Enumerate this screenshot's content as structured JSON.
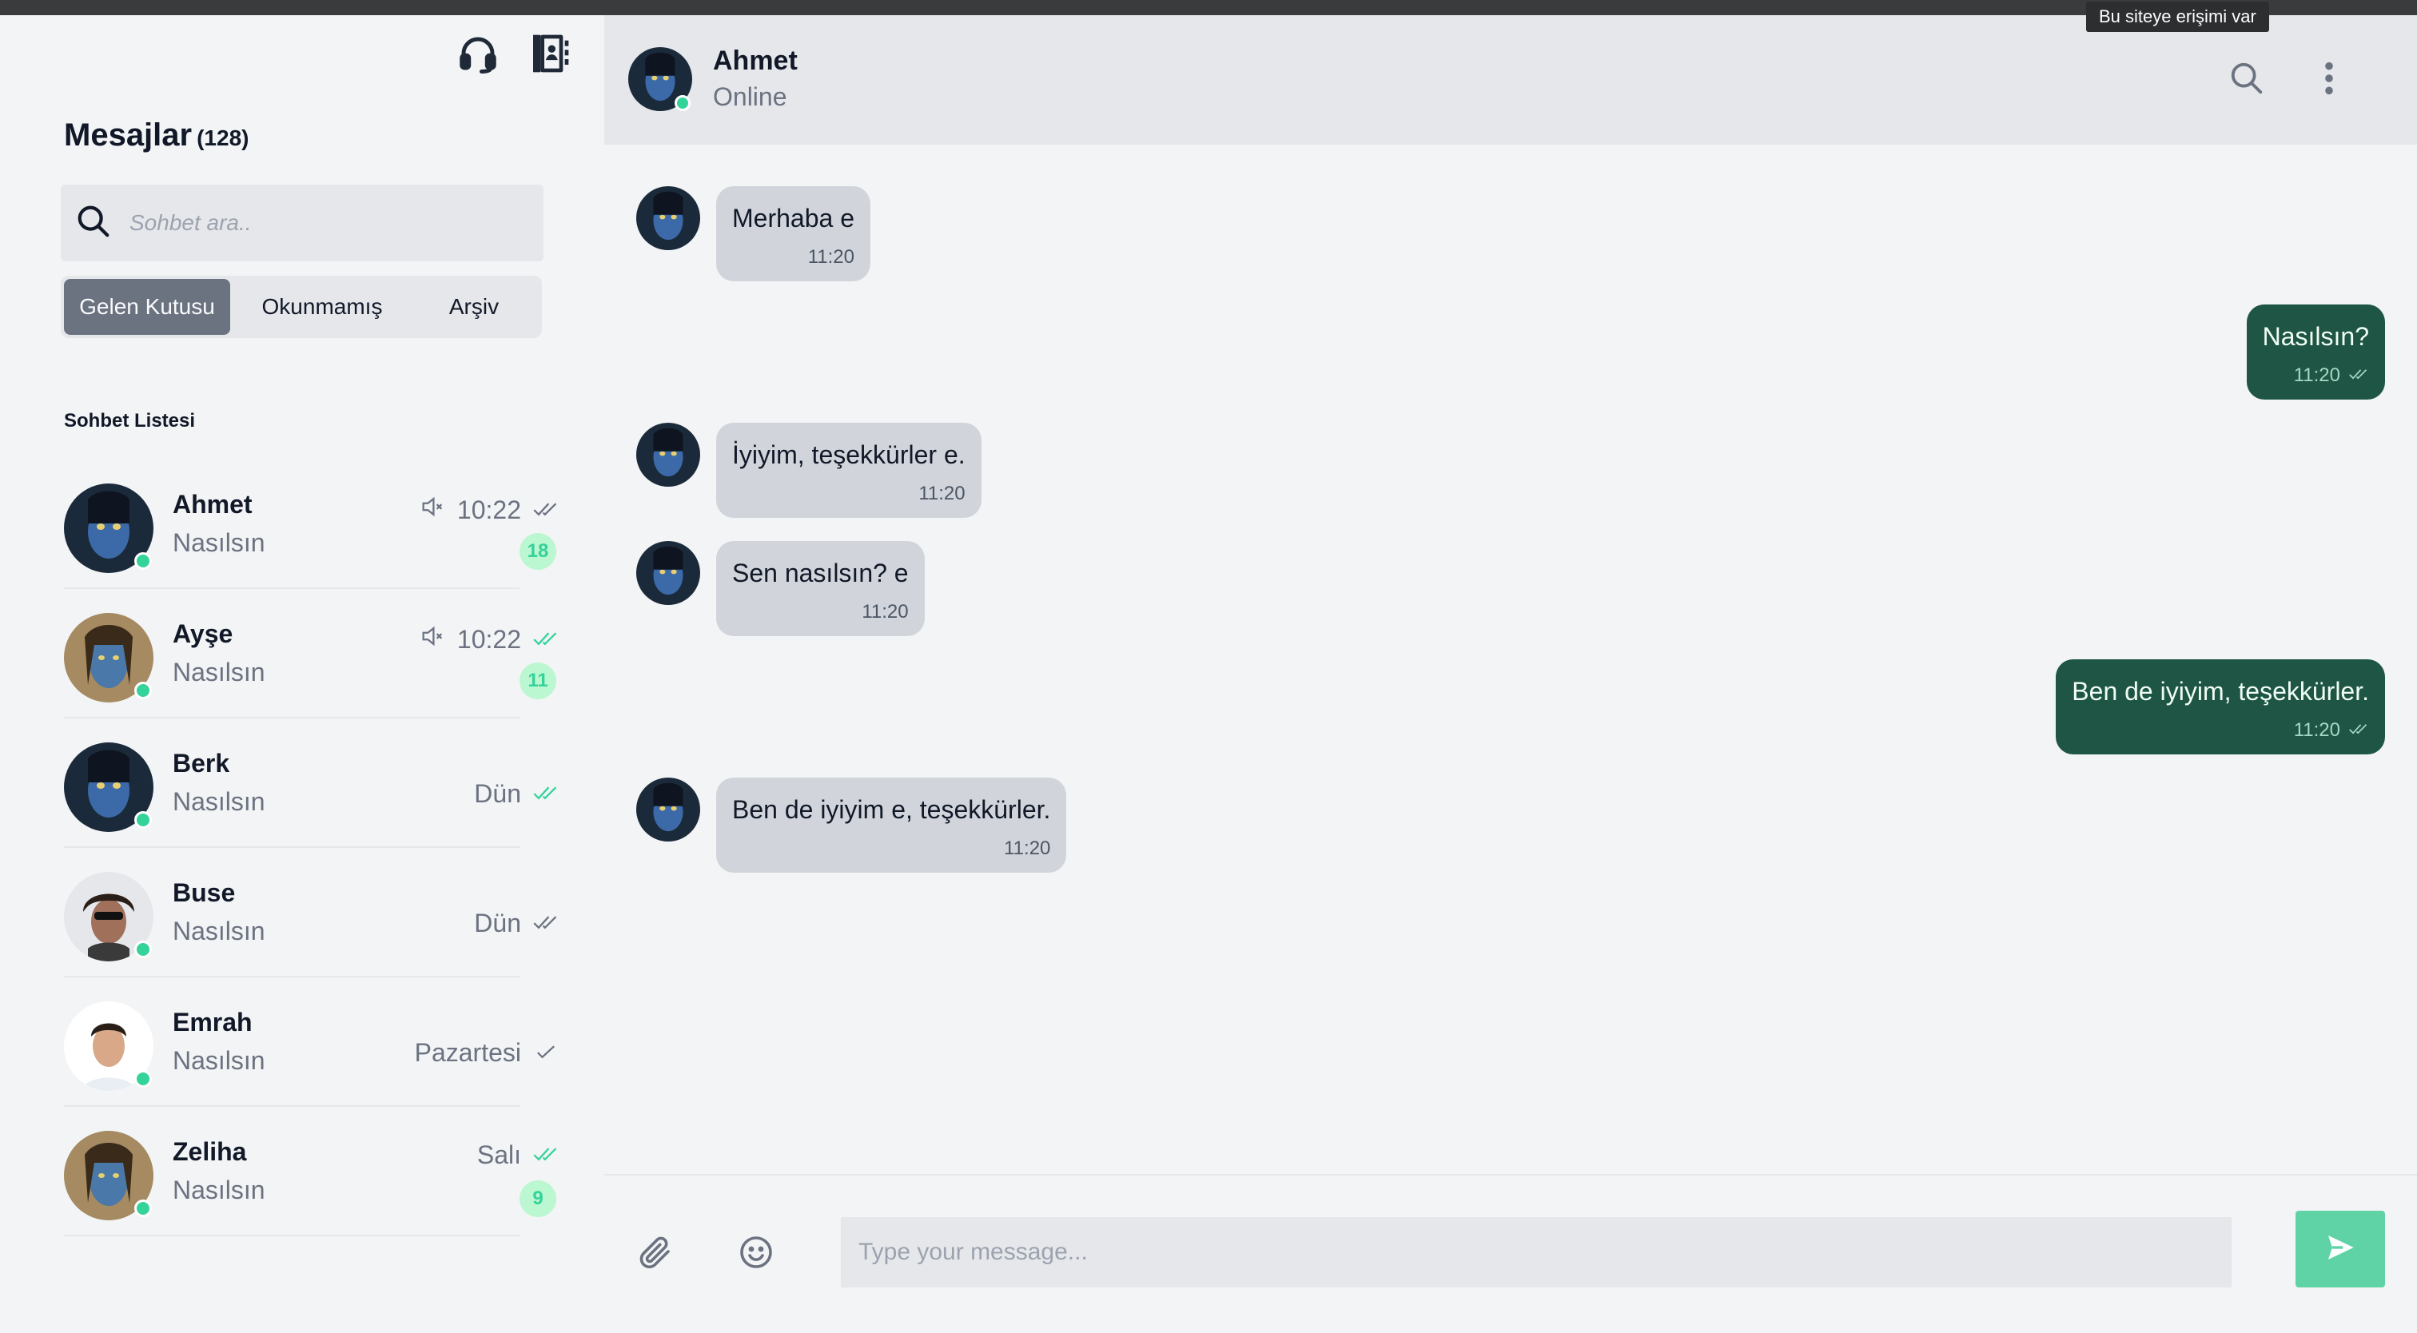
{
  "browser": {
    "tooltip": "Bu siteye erişimi var"
  },
  "sidebar": {
    "icons": [
      "headset-icon",
      "contacts-book-icon"
    ],
    "title": "Mesajlar",
    "count": "(128)",
    "search_placeholder": "Sohbet ara..",
    "tabs": [
      {
        "label": "Gelen Kutusu",
        "active": true
      },
      {
        "label": "Okunmamış",
        "active": false
      },
      {
        "label": "Arşiv",
        "active": false
      }
    ],
    "list_title": "Sohbet Listesi",
    "chats": [
      {
        "name": "Ahmet",
        "message": "Nasılsın",
        "time": "10:22",
        "muted": true,
        "check": "double-gray",
        "unread": "18"
      },
      {
        "name": "Ayşe",
        "message": "Nasılsın",
        "time": "10:22",
        "muted": true,
        "check": "double-green",
        "unread": "11"
      },
      {
        "name": "Berk",
        "message": "Nasılsın",
        "time": "Dün",
        "muted": false,
        "check": "double-green",
        "unread": ""
      },
      {
        "name": "Buse",
        "message": "Nasılsın",
        "time": "Dün",
        "muted": false,
        "check": "double-gray",
        "unread": ""
      },
      {
        "name": "Emrah",
        "message": "Nasılsın",
        "time": "Pazartesi",
        "muted": false,
        "check": "single-gray",
        "unread": ""
      },
      {
        "name": "Zeliha",
        "message": "Nasılsın",
        "time": "Salı",
        "muted": false,
        "check": "double-green",
        "unread": "9"
      }
    ]
  },
  "header": {
    "name": "Ahmet",
    "status": "Online"
  },
  "messages": [
    {
      "dir": "in",
      "text": "Merhaba e",
      "time": "11:20"
    },
    {
      "dir": "out",
      "text": "Nasılsın?",
      "time": "11:20"
    },
    {
      "dir": "in",
      "text": "İyiyim, teşekkürler e.",
      "time": "11:20"
    },
    {
      "dir": "in",
      "text": "Sen nasılsın? e",
      "time": "11:20"
    },
    {
      "dir": "out",
      "text": "Ben de iyiyim, teşekkürler.",
      "time": "11:20"
    },
    {
      "dir": "in",
      "text": "Ben de iyiyim e, teşekkürler.",
      "time": "11:20"
    }
  ],
  "composer": {
    "placeholder": "Type your message..."
  },
  "colors": {
    "accent": "#5fd3a5",
    "bubble_out": "#1e5544",
    "bubble_in": "#d1d5db",
    "online": "#34d399"
  }
}
